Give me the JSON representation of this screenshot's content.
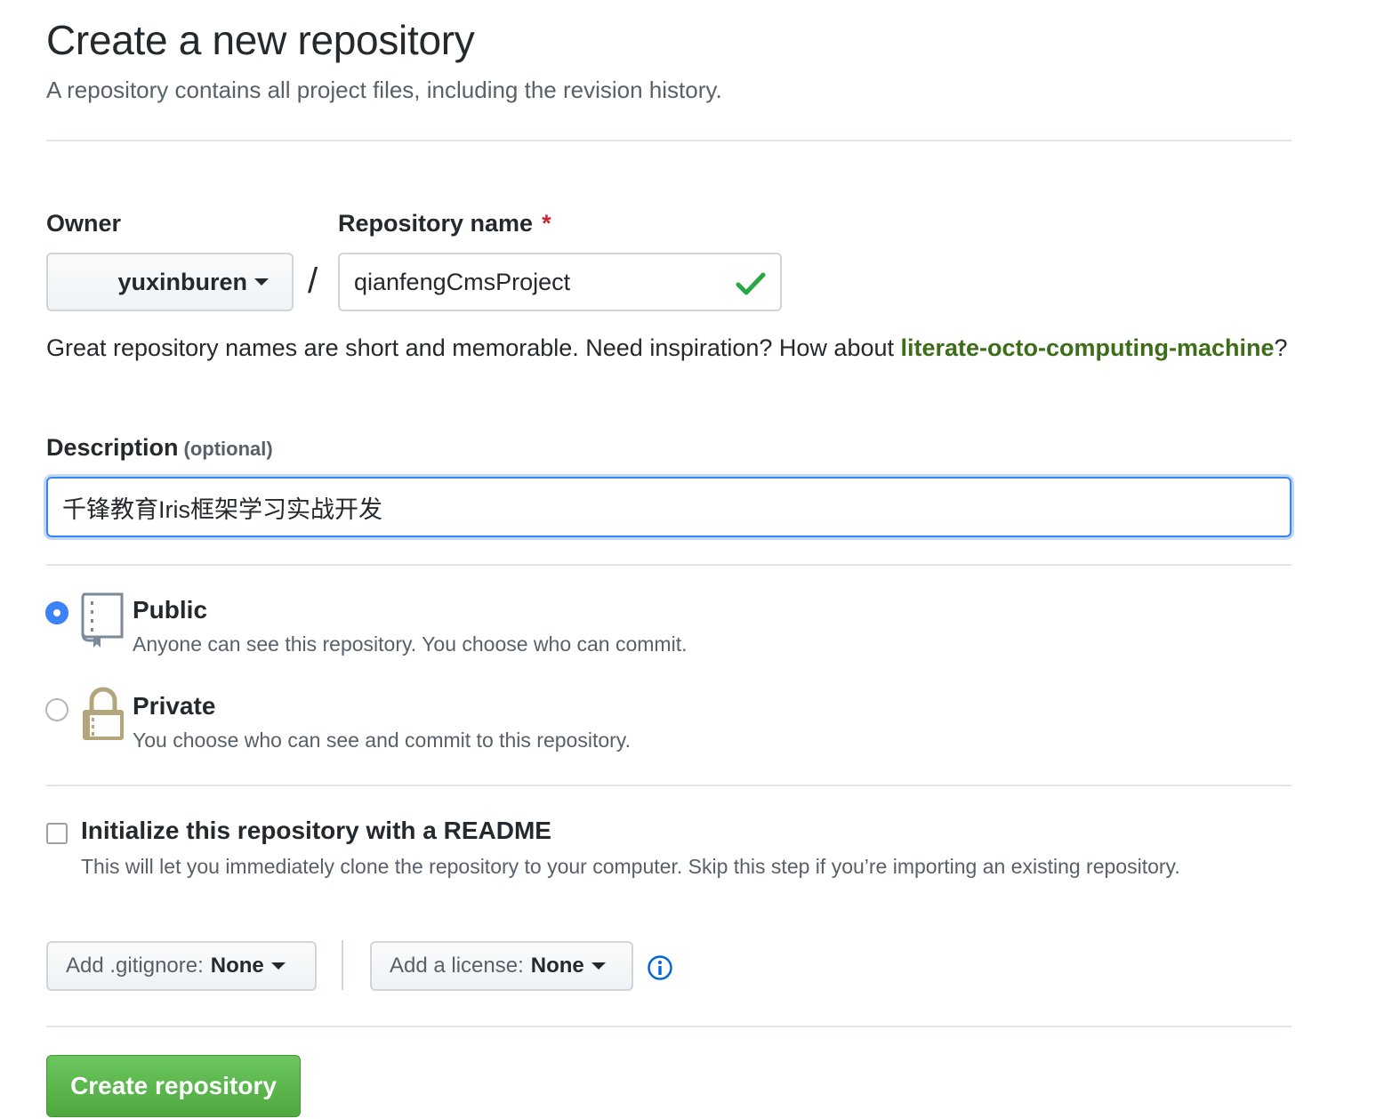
{
  "page": {
    "title": "Create a new repository",
    "subtitle": "A repository contains all project files, including the revision history."
  },
  "owner": {
    "label": "Owner",
    "value": "yuxinburen"
  },
  "repo_name": {
    "label": "Repository name",
    "required_mark": "*",
    "value": "qianfengCmsProject",
    "separator": "/"
  },
  "hint": {
    "text": "Great repository names are short and memorable. Need inspiration? How about ",
    "suggestion": "literate-octo-computing-machine",
    "suffix": "?"
  },
  "description": {
    "label": "Description",
    "optional": "(optional)",
    "value": "千锋教育Iris框架学习实战开发"
  },
  "visibility": {
    "public": {
      "title": "Public",
      "desc": "Anyone can see this repository. You choose who can commit.",
      "selected": true
    },
    "private": {
      "title": "Private",
      "desc": "You choose who can see and commit to this repository.",
      "selected": false
    }
  },
  "readme": {
    "title": "Initialize this repository with a README",
    "desc": "This will let you immediately clone the repository to your computer. Skip this step if you’re importing an existing repository.",
    "checked": false
  },
  "gitignore": {
    "label": "Add .gitignore:",
    "value": "None"
  },
  "license": {
    "label": "Add a license:",
    "value": "None"
  },
  "submit": {
    "label": "Create repository"
  },
  "colors": {
    "accent_blue": "#3b82f6",
    "success_green": "#28a745",
    "suggestion_green": "#3c6e19",
    "required_red": "#cb2431"
  }
}
